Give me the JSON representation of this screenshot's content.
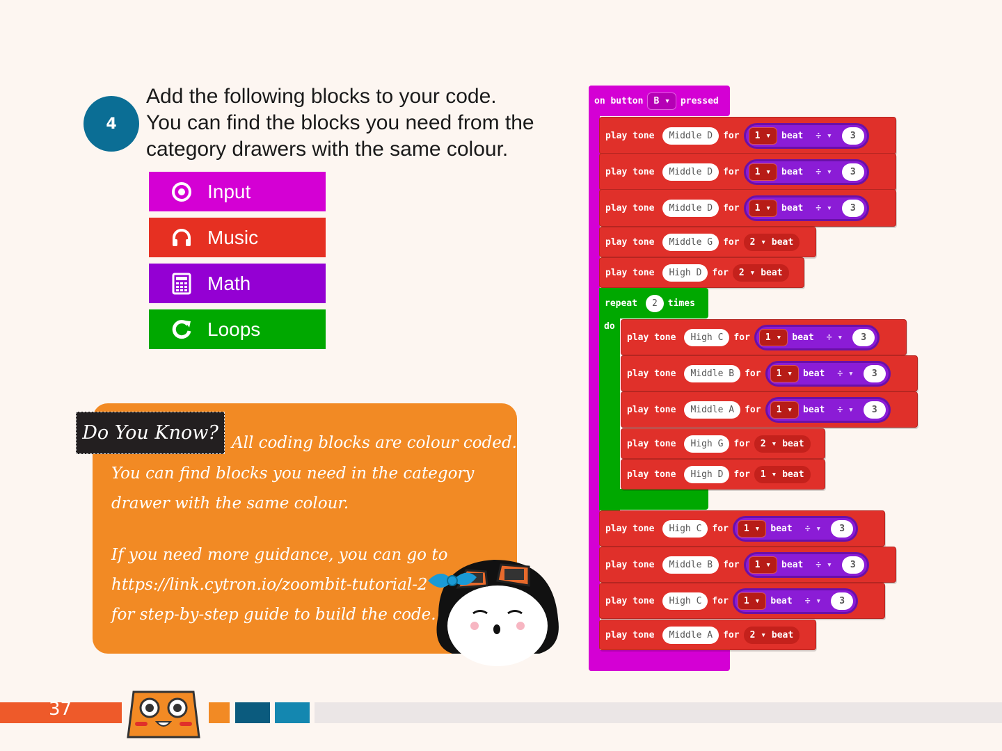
{
  "step": {
    "number": "4"
  },
  "instructions": [
    "Add the following blocks to your code.",
    "You can find the blocks you need from the",
    "category drawers with the same colour."
  ],
  "categories": [
    {
      "label": "Input",
      "icon": "target-icon",
      "color": "#d400d4"
    },
    {
      "label": "Music",
      "icon": "headphones-icon",
      "color": "#e63022"
    },
    {
      "label": "Math",
      "icon": "calculator-icon",
      "color": "#9400d3"
    },
    {
      "label": "Loops",
      "icon": "refresh-icon",
      "color": "#00a800"
    }
  ],
  "do_you_know": {
    "title": "Do You Know?",
    "line1": "All coding blocks are colour coded.",
    "line2": "You can find blocks you need in the category",
    "line3": "drawer with the same colour.",
    "line4": "If you need more guidance, you can go to",
    "line5": "https://link.cytron.io/zoombit-tutorial-2",
    "line6": "for step-by-step guide to build the code."
  },
  "code": {
    "event": {
      "prefix": "on button",
      "button": "B",
      "suffix": "pressed"
    },
    "play_tone": "play tone",
    "for": "for",
    "beat": "beat",
    "repeat": "repeat",
    "repeat_count": "2",
    "times": "times",
    "do": "do",
    "div_op": "÷",
    "tones": [
      {
        "note": "Middle D",
        "beats": "1",
        "divisor": "3"
      },
      {
        "note": "Middle D",
        "beats": "1",
        "divisor": "3"
      },
      {
        "note": "Middle D",
        "beats": "1",
        "divisor": "3"
      },
      {
        "note": "Middle G",
        "beats": "2",
        "divisor": ""
      },
      {
        "note": "High D",
        "beats": "2",
        "divisor": ""
      }
    ],
    "loop_tones": [
      {
        "note": "High C",
        "beats": "1",
        "divisor": "3"
      },
      {
        "note": "Middle B",
        "beats": "1",
        "divisor": "3"
      },
      {
        "note": "Middle A",
        "beats": "1",
        "divisor": "3"
      },
      {
        "note": "High G",
        "beats": "2",
        "divisor": ""
      },
      {
        "note": "High D",
        "beats": "1",
        "divisor": ""
      }
    ],
    "after_tones": [
      {
        "note": "High C",
        "beats": "1",
        "divisor": "3"
      },
      {
        "note": "Middle B",
        "beats": "1",
        "divisor": "3"
      },
      {
        "note": "High C",
        "beats": "1",
        "divisor": "3"
      },
      {
        "note": "Middle A",
        "beats": "2",
        "divisor": ""
      }
    ]
  },
  "footer": {
    "page_number": "37"
  },
  "colors": {
    "event": "#d400d4",
    "music": "#e0302a",
    "loops": "#00a800",
    "math": "#8b1cd6",
    "step_circle": "#0b6e95",
    "callout": "#f28a24",
    "footer_orange": "#ee5a2a",
    "footer_blue_dark": "#0b5b7e",
    "footer_blue": "#1487b0"
  }
}
